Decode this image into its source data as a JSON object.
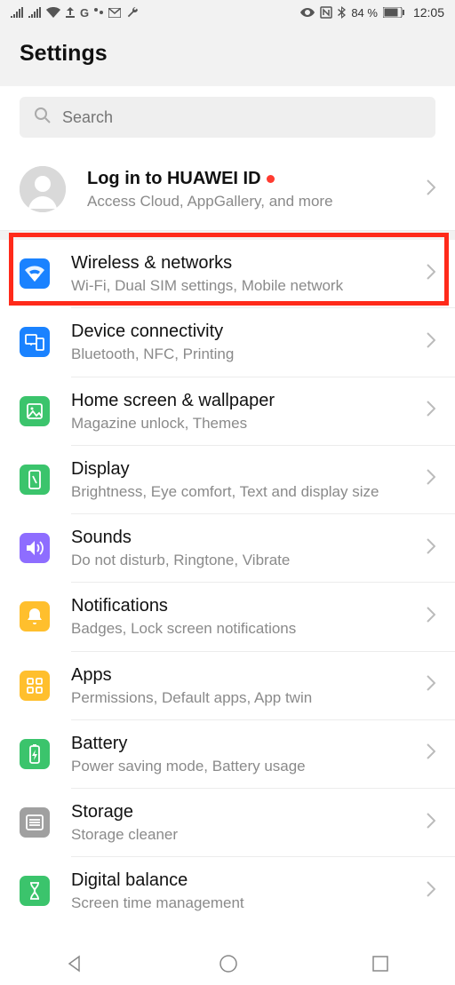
{
  "status": {
    "battery_pct": "84 %",
    "time": "12:05"
  },
  "header": {
    "title": "Settings"
  },
  "search": {
    "placeholder": "Search"
  },
  "huawei": {
    "title": "Log in to HUAWEI ID",
    "subtitle": "Access Cloud, AppGallery, and more"
  },
  "items": [
    {
      "title": "Wireless & networks",
      "subtitle": "Wi-Fi, Dual SIM settings, Mobile network"
    },
    {
      "title": "Device connectivity",
      "subtitle": "Bluetooth, NFC, Printing"
    },
    {
      "title": "Home screen & wallpaper",
      "subtitle": "Magazine unlock, Themes"
    },
    {
      "title": "Display",
      "subtitle": "Brightness, Eye comfort, Text and display size"
    },
    {
      "title": "Sounds",
      "subtitle": "Do not disturb, Ringtone, Vibrate"
    },
    {
      "title": "Notifications",
      "subtitle": "Badges, Lock screen notifications"
    },
    {
      "title": "Apps",
      "subtitle": "Permissions, Default apps, App twin"
    },
    {
      "title": "Battery",
      "subtitle": "Power saving mode, Battery usage"
    },
    {
      "title": "Storage",
      "subtitle": "Storage cleaner"
    },
    {
      "title": "Digital balance",
      "subtitle": "Screen time management"
    }
  ]
}
